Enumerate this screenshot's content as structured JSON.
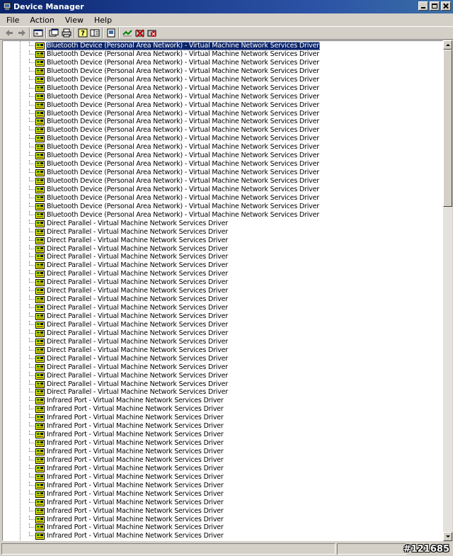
{
  "window": {
    "title": "Device Manager"
  },
  "menu": [
    "File",
    "Action",
    "View",
    "Help"
  ],
  "toolbar_icons": [
    "back-arrow-icon",
    "forward-arrow-icon",
    "up-level-icon",
    "properties-icon",
    "print-icon",
    "help-icon",
    "show-hide-icon",
    "refresh-icon",
    "scan-hardware-icon",
    "disable-device-icon",
    "uninstall-device-icon"
  ],
  "device_groups": [
    {
      "label": "Bluetooth Device (Personal Area Network) - Virtual Machine Network Services Driver",
      "count": 21
    },
    {
      "label": "Direct Parallel - Virtual Machine Network Services Driver",
      "count": 21
    },
    {
      "label": "Infrared Port - Virtual Machine Network Services Driver",
      "count": 17
    }
  ],
  "selected_index": 0,
  "watermark": "#121685",
  "colors": {
    "selection": "#0a246a",
    "title_bar": "#0a246a"
  }
}
